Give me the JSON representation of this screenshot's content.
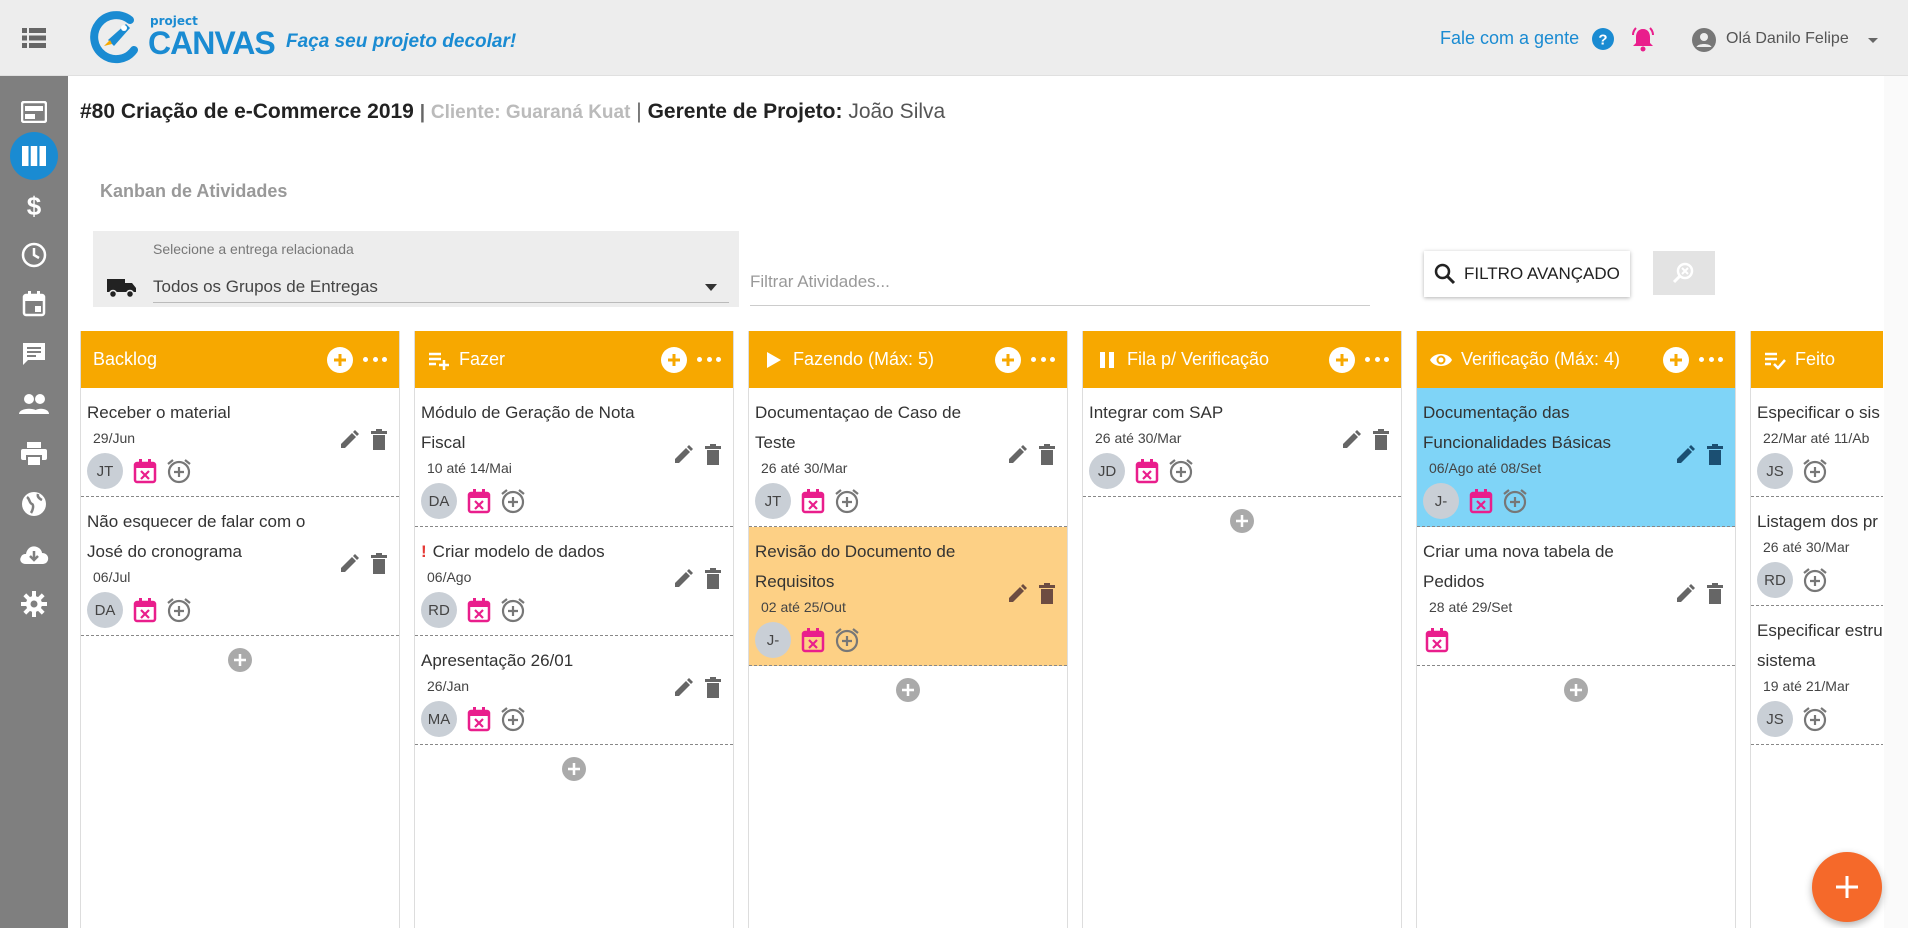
{
  "header": {
    "logo_small": "project",
    "logo_main": "CANVAS",
    "tagline": "Faça seu projeto decolar!",
    "help_link": "Fale com a gente",
    "user_greeting": "Olá Danilo Felipe"
  },
  "sidebar": {
    "items": [
      {
        "icon": "dashboard-icon"
      },
      {
        "icon": "kanban-icon"
      },
      {
        "icon": "dollar-icon"
      },
      {
        "icon": "clock-icon"
      },
      {
        "icon": "calendar-icon"
      },
      {
        "icon": "chat-icon"
      },
      {
        "icon": "people-icon"
      },
      {
        "icon": "print-icon"
      },
      {
        "icon": "globe-icon"
      },
      {
        "icon": "cloud-download-icon"
      },
      {
        "icon": "settings-icon"
      }
    ]
  },
  "project": {
    "title": "#80 Criação de e-Commerce 2019",
    "client": "Cliente: Guaraná Kuat",
    "separator": "|",
    "pm_label": "Gerente de Projeto:",
    "pm_name": "João Silva"
  },
  "section_title": "Kanban de Atividades",
  "filters": {
    "delivery_label": "Selecione a entrega relacionada",
    "delivery_value": "Todos os Grupos de Entregas",
    "filter_placeholder": "Filtrar Atividades...",
    "advanced_label": "FILTRO AVANÇADO"
  },
  "columns": [
    {
      "title": "Backlog",
      "icon": "",
      "cards": [
        {
          "title": "Receber o material",
          "date": "29/Jun",
          "avatar": "JT",
          "color": "",
          "excl": ""
        },
        {
          "title": "Não esquecer de falar com o José do cronograma",
          "date": "06/Jul",
          "avatar": "DA",
          "color": "",
          "excl": ""
        }
      ]
    },
    {
      "title": "Fazer",
      "icon": "playlist-add-icon",
      "cards": [
        {
          "title": "Módulo de Geração de Nota Fiscal",
          "date": "10 até 14/Mai",
          "avatar": "DA",
          "color": "",
          "excl": ""
        },
        {
          "title": "Criar modelo de dados",
          "date": "06/Ago",
          "avatar": "RD",
          "color": "",
          "excl": "!"
        },
        {
          "title": "Apresentação 26/01",
          "date": "26/Jan",
          "avatar": "MA",
          "color": "",
          "excl": ""
        }
      ]
    },
    {
      "title": "Fazendo (Máx: 5)",
      "icon": "play-icon",
      "cards": [
        {
          "title": "Documentaçao de Caso de Teste",
          "date": "26 até 30/Mar",
          "avatar": "JT",
          "color": "",
          "excl": ""
        },
        {
          "title": "Revisão do Documento de Requisitos",
          "date": "02 até 25/Out",
          "avatar": "J-",
          "color": "orange",
          "excl": ""
        }
      ]
    },
    {
      "title": "Fila p/ Verificação",
      "icon": "pause-icon",
      "cards": [
        {
          "title": "Integrar com SAP",
          "date": "26 até 30/Mar",
          "avatar": "JD",
          "color": "",
          "excl": ""
        }
      ]
    },
    {
      "title": "Verificação (Máx: 4)",
      "icon": "eye-icon",
      "cards": [
        {
          "title": "Documentação das Funcionalidades Básicas",
          "date": "06/Ago até 08/Set",
          "avatar": "J-",
          "color": "blue",
          "excl": ""
        },
        {
          "title": "Criar uma nova tabela de Pedidos",
          "date": "28 até 29/Set",
          "avatar": "",
          "color": "",
          "excl": ""
        }
      ]
    },
    {
      "title": "Feito",
      "icon": "playlist-check-icon",
      "cards": [
        {
          "title": "Especificar o sis",
          "date": "22/Mar até 11/Ab",
          "avatar": "JS",
          "color": "",
          "excl": "",
          "noCal": true
        },
        {
          "title": "Listagem dos pr",
          "date": "26 até 30/Mar",
          "avatar": "RD",
          "color": "",
          "excl": "",
          "noCal": true
        },
        {
          "title": "Especificar estru sistema",
          "date": "19 até 21/Mar",
          "avatar": "JS",
          "color": "",
          "excl": "",
          "noCal": true
        }
      ]
    }
  ],
  "colors": {
    "brand_blue": "#1a8bd2",
    "column_header": "#f7a800",
    "card_blue": "#7fd4f7",
    "card_orange": "#fdd085",
    "fab": "#f5692a",
    "calendar_pink": "#e91e8c",
    "bell_pink": "#e91e8c"
  }
}
